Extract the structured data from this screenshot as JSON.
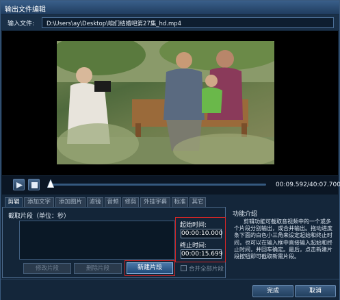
{
  "window": {
    "title": "输出文件编辑"
  },
  "input_file": {
    "label": "输入文件:",
    "path": "D:\\Users\\ay\\Desktop\\咱们结婚吧第27集_hd.mp4"
  },
  "player": {
    "time_display": "00:09.592/40:07.700",
    "progress": 0.004,
    "play_icon": "play-icon",
    "stop_icon": "stop-icon"
  },
  "tabs": [
    "剪辑",
    "添加文字",
    "添加图片",
    "滤镜",
    "音频",
    "修剪",
    "外挂字幕",
    "标准",
    "其它"
  ],
  "clip_panel": {
    "caption": "截取片段（单位：秒）",
    "start_label": "起始时间:",
    "start_value": "00:00:10.000",
    "end_label": "终止时间:",
    "end_value": "00:00:15.699",
    "btn_modify": "修改片段",
    "btn_delete": "删除片段",
    "btn_new": "新建片段",
    "merge_label": "合并全部片段"
  },
  "info": {
    "head": "功能介绍",
    "body": "剪辑功能可截取音视频中的一个或多个片段分别输出，或合并输出。拖动进度条下面的白色小三角来设定起始和终止时间，也可以在输入框中直接输入起始和终止时间，并回车确定。最后，点击新建片段按钮即可截取新需片段。"
  },
  "footer": {
    "ok": "完成",
    "cancel": "取消"
  },
  "colors": {
    "highlight": "#d32626",
    "window_bg": "#14263a"
  }
}
